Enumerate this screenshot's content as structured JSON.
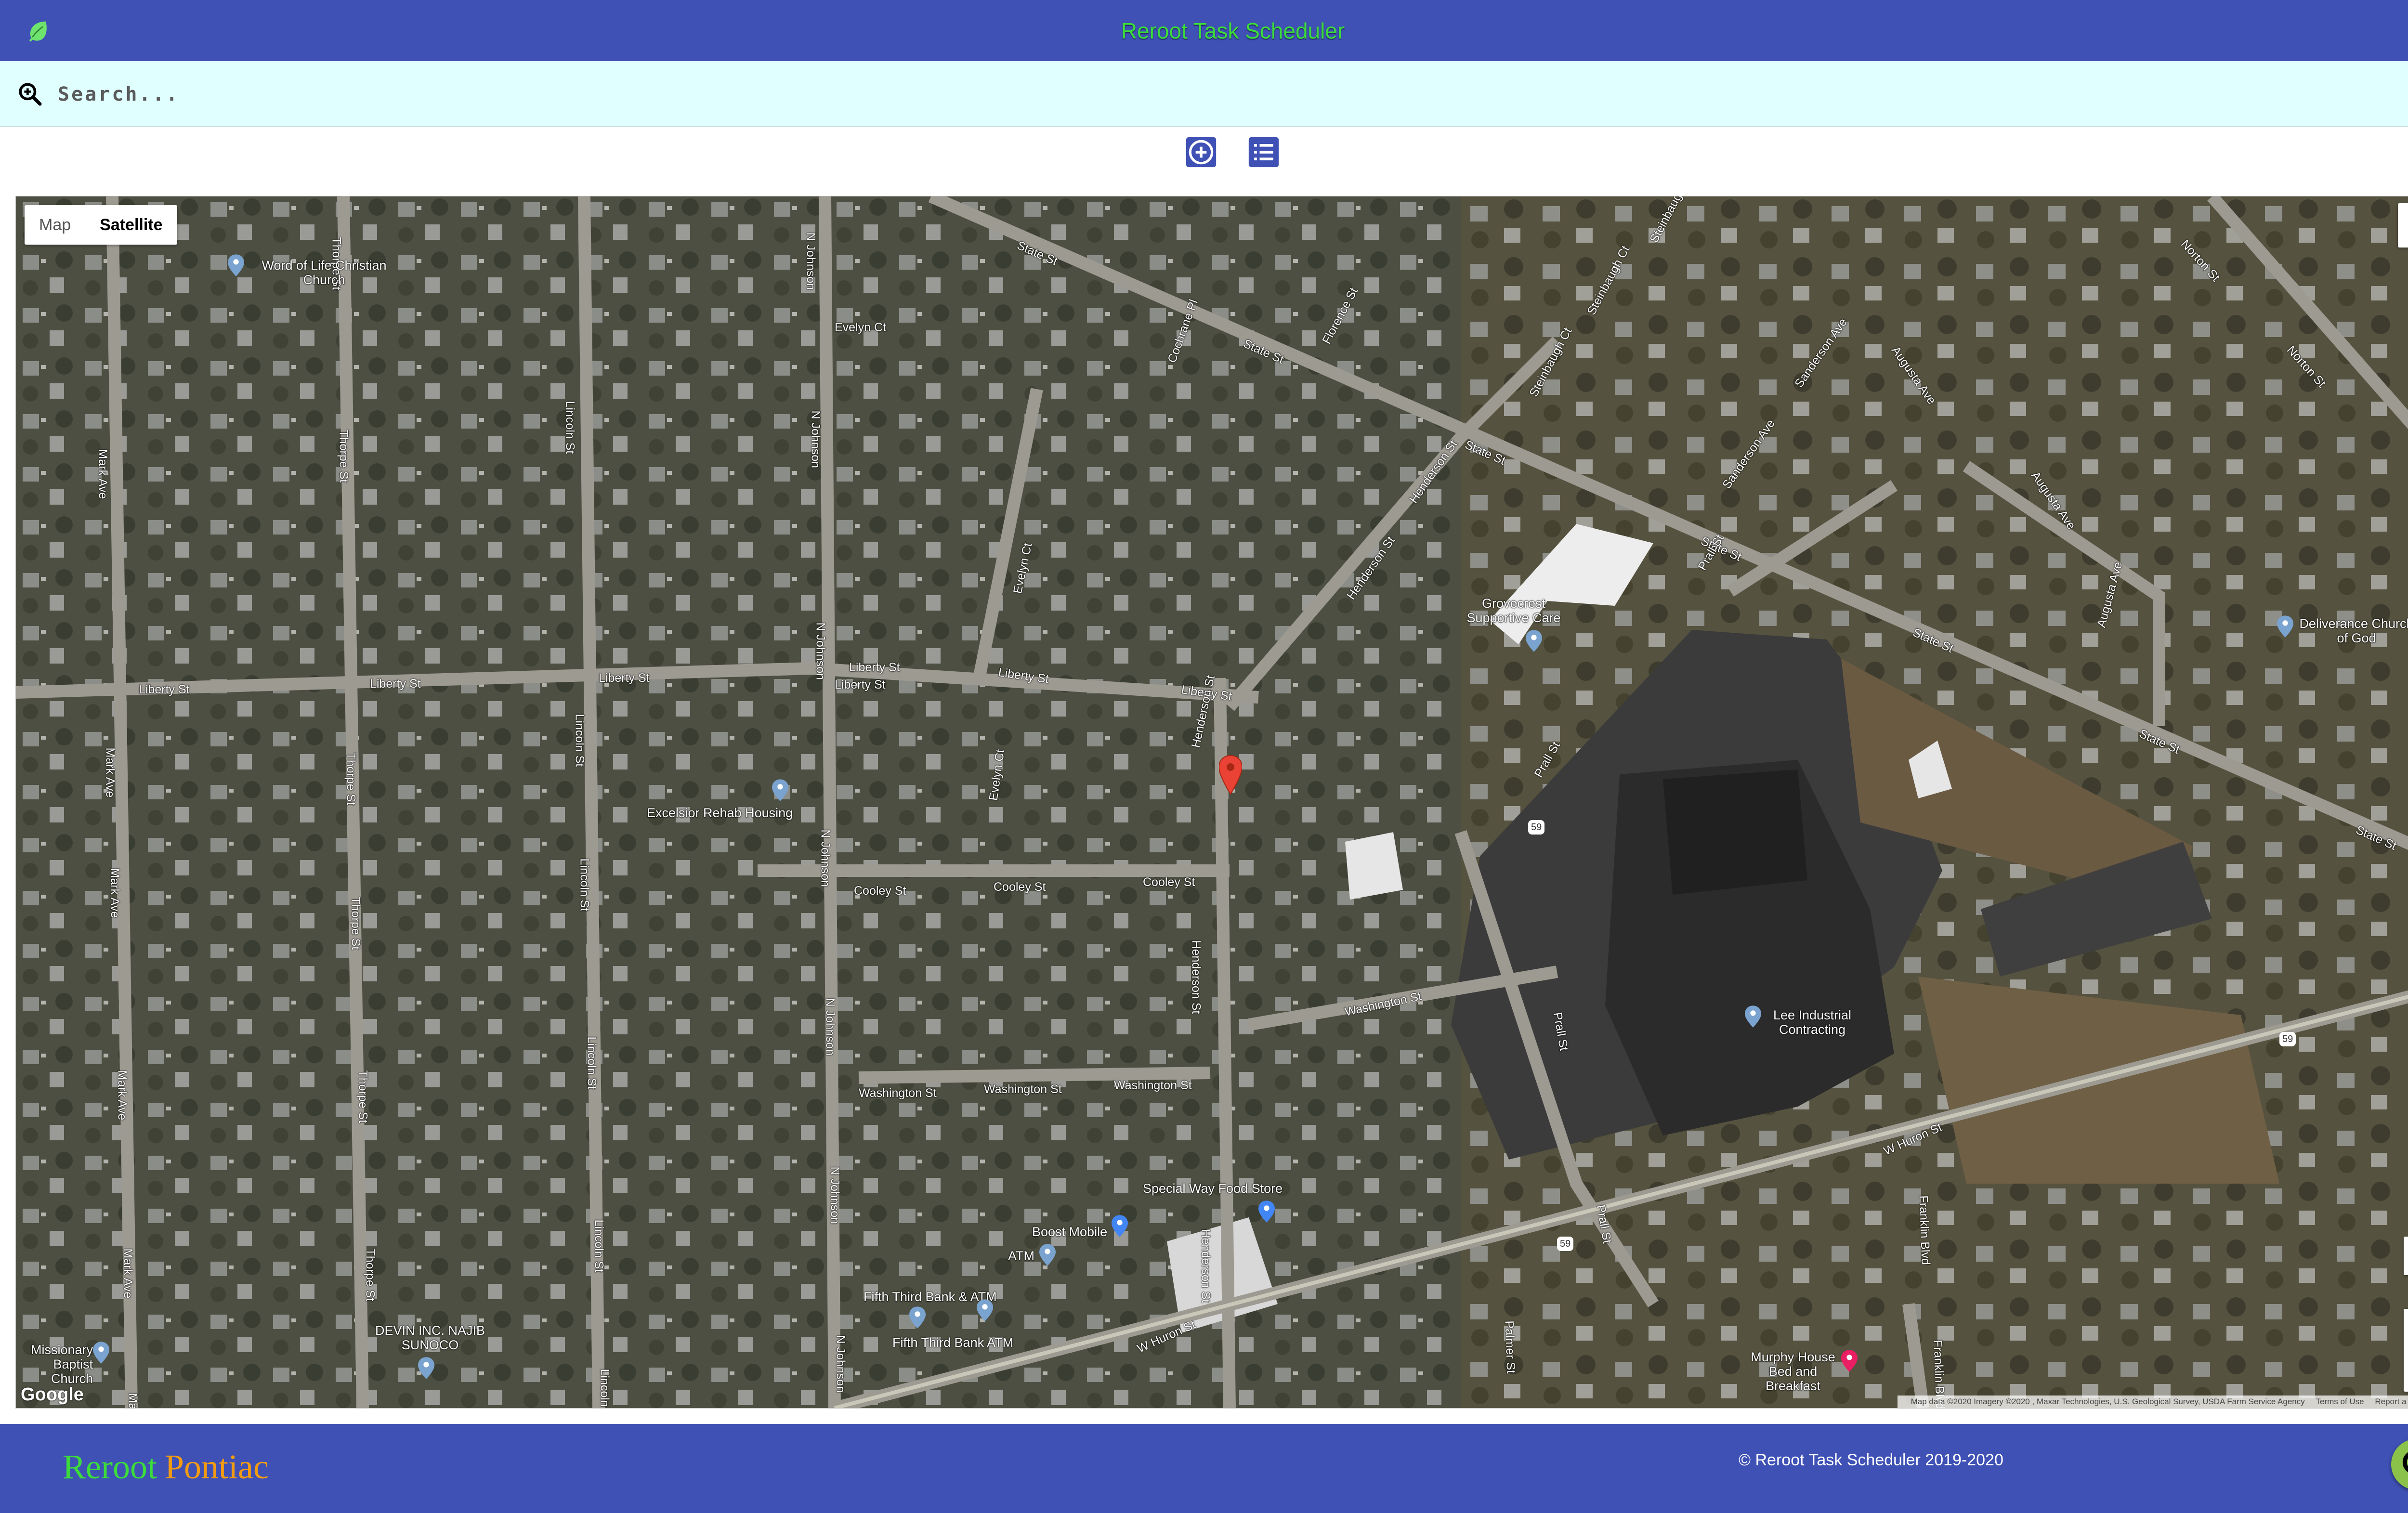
{
  "header": {
    "title": "Reroot Task Scheduler",
    "left_icon": "leaf-icon",
    "right_icon": "info-icon",
    "title_color": "#3cdc3c",
    "bar_color": "#3f51b5"
  },
  "search": {
    "icon": "zoom-search-icon",
    "placeholder": "Search...",
    "value": ""
  },
  "toolbar": {
    "add_icon": "add-circle-icon",
    "list_icon": "list-icon"
  },
  "map": {
    "type_control": {
      "options": [
        "Map",
        "Satellite"
      ],
      "selected": "Satellite"
    },
    "streets": [
      "State St",
      "State St",
      "State St",
      "State St",
      "State St",
      "State St",
      "State St",
      "Evelyn Ct",
      "Evelyn Ct",
      "Evelyn Ct",
      "N Johnson",
      "N Johnson",
      "N Johnson",
      "N Johnson",
      "N Johnson",
      "N Johnson",
      "N Johnson",
      "Liberty St",
      "Liberty St",
      "Liberty St",
      "Liberty St",
      "Liberty St",
      "Liberty St",
      "Liberty St",
      "Mark Ave",
      "Mark Ave",
      "Mark Ave",
      "Mark Ave",
      "Mark Ave",
      "Mark Ave",
      "Thorpe St",
      "Thorpe St",
      "Thorpe St",
      "Thorpe St",
      "Thorpe St",
      "Thorpe St",
      "Lincoln St",
      "Lincoln St",
      "Lincoln St",
      "Lincoln St",
      "Lincoln St",
      "Lincoln St",
      "Cooley St",
      "Cooley St",
      "Cooley St",
      "Washington St",
      "Washington St",
      "Washington St",
      "Washington St",
      "Henderson St",
      "Henderson St",
      "Henderson St",
      "Henderson St",
      "Henderson St",
      "Cochrane Pl",
      "Florence St",
      "Steinbaugh Ct",
      "Steinbaugh Ct",
      "Steinbaugh Ct",
      "Sanderson Ave",
      "Sanderson Ave",
      "Augusta Ave",
      "Augusta Ave",
      "Augusta Ave",
      "Norton St",
      "Norton St",
      "Prall St",
      "Prall St",
      "Prall St",
      "Prall St",
      "W Huron St",
      "W Huron St",
      "Franklin Blvd",
      "Franklin Blvd",
      "Palmer St"
    ],
    "route_shields": [
      "59",
      "59",
      "59"
    ],
    "places": [
      "Word of Life Christian Church",
      "Grovecrest Supportive Care",
      "Deliverance Church of God",
      "Excelsior Rehab Housing",
      "Lee Industrial Contracting",
      "Special Way Food Store",
      "Boost Mobile",
      "ATM",
      "Fifth Third Bank & ATM",
      "Fifth Third Bank ATM",
      "DEVIN INC. NAJIB SUNOCO",
      "Murphy House Bed and Breakfast",
      "Missionary Baptist Church"
    ],
    "marker_icon": "red-location-pin-icon",
    "google_logo": "Google",
    "attribution": {
      "data": "Map data ©2020 Imagery ©2020 , Maxar Technologies, U.S. Geological Survey, USDA Farm Service Agency",
      "terms": "Terms of Use",
      "report": "Report a map error"
    },
    "zoom_in": "+",
    "zoom_out": "−"
  },
  "footer": {
    "brand_first": "Reroot",
    "brand_second": "Pontiac",
    "copyright": "© Reroot Task Scheduler 2019-2020",
    "fab_icon": "search-icon",
    "fab_color": "#8bc34a"
  }
}
